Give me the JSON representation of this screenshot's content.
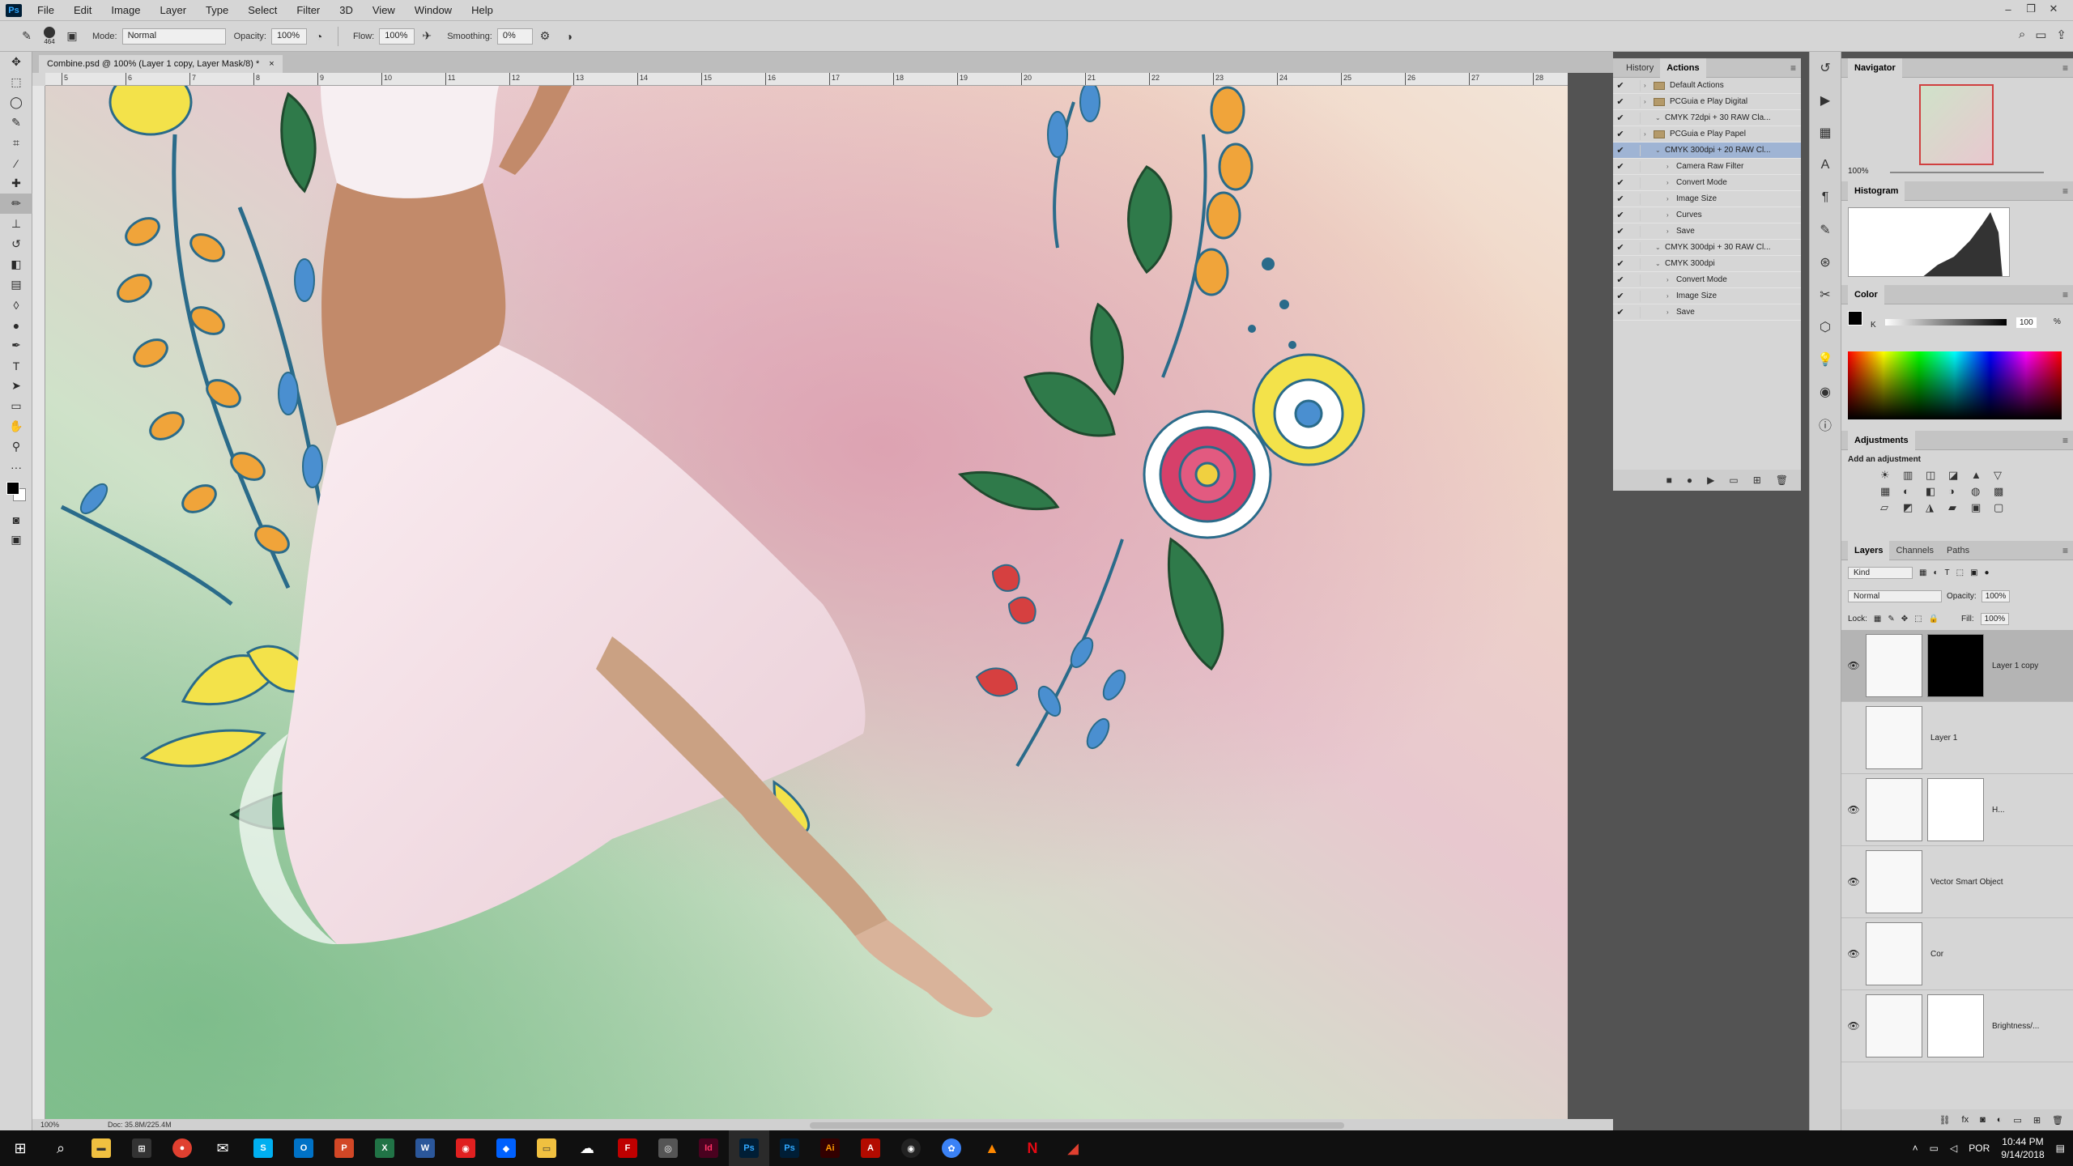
{
  "app": {
    "logo": "Ps"
  },
  "menu": [
    "File",
    "Edit",
    "Image",
    "Layer",
    "Type",
    "Select",
    "Filter",
    "3D",
    "View",
    "Window",
    "Help"
  ],
  "options": {
    "brush_size": "464",
    "mode_label": "Mode:",
    "mode_value": "Normal",
    "opacity_label": "Opacity:",
    "opacity_value": "100%",
    "flow_label": "Flow:",
    "flow_value": "100%",
    "smoothing_label": "Smoothing:",
    "smoothing_value": "0%"
  },
  "document": {
    "tab_title": "Combine.psd @ 100% (Layer 1 copy, Layer Mask/8) *",
    "close": "×",
    "zoom": "100%",
    "doc_info": "Doc: 35.8M/225.4M"
  },
  "rulers": {
    "h": [
      "5",
      "6",
      "7",
      "8",
      "9",
      "10",
      "11",
      "12",
      "13",
      "14",
      "15",
      "16",
      "17",
      "18",
      "19",
      "20",
      "21",
      "22",
      "23",
      "24",
      "25",
      "26",
      "27",
      "28"
    ]
  },
  "actions_panel": {
    "tabs": [
      "History",
      "Actions"
    ],
    "rows": [
      {
        "label": "Default Actions",
        "indent": 0,
        "type": "set"
      },
      {
        "label": "PCGuia e Play Digital",
        "indent": 0,
        "type": "set"
      },
      {
        "label": "CMYK 72dpi + 30 RAW Cla...",
        "indent": 1,
        "type": "action"
      },
      {
        "label": "PCGuia e Play Papel",
        "indent": 0,
        "type": "set"
      },
      {
        "label": "CMYK 300dpi + 20 RAW Cl...",
        "indent": 1,
        "type": "action",
        "selected": true
      },
      {
        "label": "Camera Raw Filter",
        "indent": 2,
        "type": "step"
      },
      {
        "label": "Convert Mode",
        "indent": 2,
        "type": "step"
      },
      {
        "label": "Image Size",
        "indent": 2,
        "type": "step"
      },
      {
        "label": "Curves",
        "indent": 2,
        "type": "step"
      },
      {
        "label": "Save",
        "indent": 2,
        "type": "step"
      },
      {
        "label": "CMYK 300dpi + 30 RAW Cl...",
        "indent": 1,
        "type": "action"
      },
      {
        "label": "CMYK 300dpi",
        "indent": 1,
        "type": "action"
      },
      {
        "label": "Convert Mode",
        "indent": 2,
        "type": "step"
      },
      {
        "label": "Image Size",
        "indent": 2,
        "type": "step"
      },
      {
        "label": "Save",
        "indent": 2,
        "type": "step"
      }
    ]
  },
  "navigator": {
    "title": "Navigator",
    "zoom": "100%"
  },
  "histogram": {
    "title": "Histogram"
  },
  "color": {
    "title": "Color",
    "channel": "K",
    "value": "100",
    "unit": "%"
  },
  "adjustments": {
    "title": "Adjustments",
    "subtitle": "Add an adjustment"
  },
  "layers_panel": {
    "tabs": [
      "Layers",
      "Channels",
      "Paths"
    ],
    "filter": "Kind",
    "blend": "Normal",
    "opacity_label": "Opacity:",
    "opacity_value": "100%",
    "lock_label": "Lock:",
    "fill_label": "Fill:",
    "fill_value": "100%",
    "layers": [
      {
        "name": "Layer 1 copy",
        "visible": true,
        "selected": true
      },
      {
        "name": "Layer 1",
        "visible": false
      },
      {
        "name": "H...",
        "visible": true
      },
      {
        "name": "Vector Smart Object",
        "visible": true
      },
      {
        "name": "Cor",
        "visible": true
      },
      {
        "name": "Brightness/...",
        "visible": true
      }
    ]
  },
  "taskbar": {
    "lang": "POR",
    "time": "10:44 PM",
    "date": "9/14/2018"
  },
  "colors": {
    "accent": "#31a8ff",
    "selection": "#9fb4d4"
  }
}
